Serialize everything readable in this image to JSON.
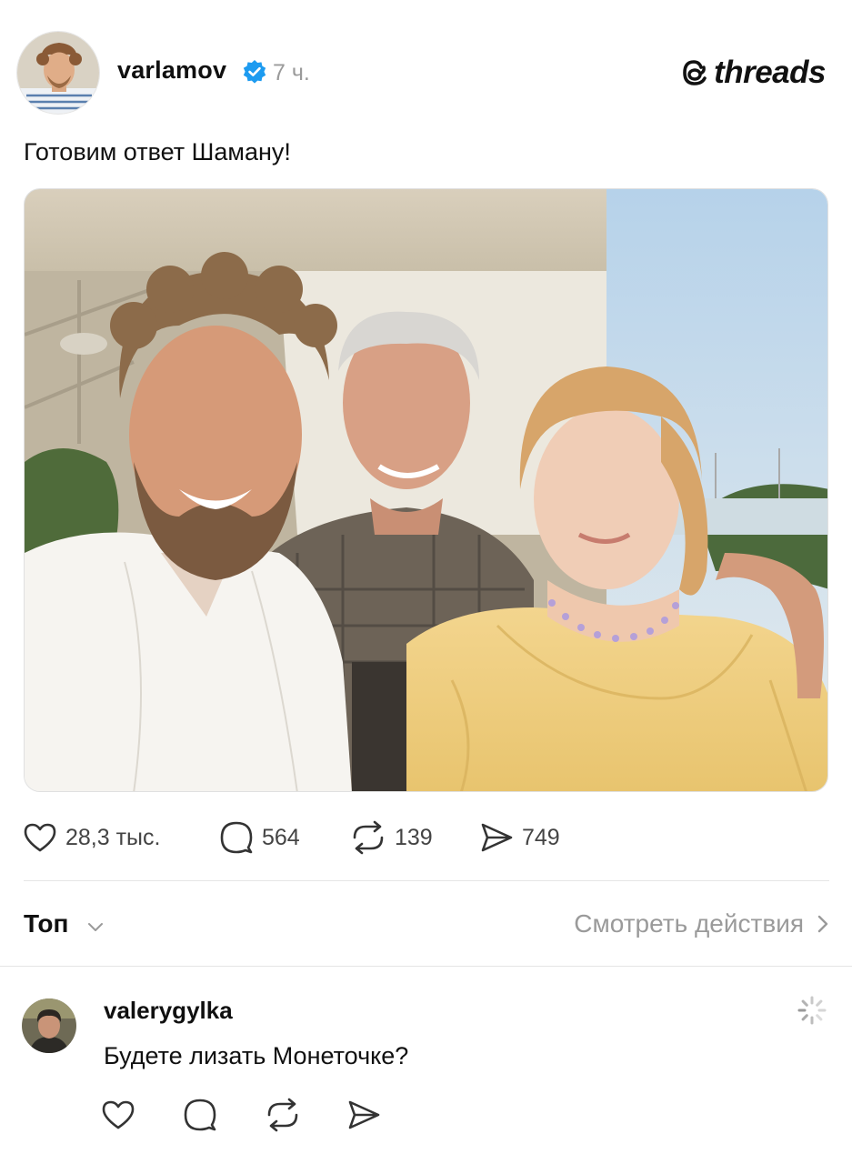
{
  "post": {
    "username": "varlamov",
    "time": "7 ч.",
    "brand": "threads",
    "text": "Готовим ответ Шаману!",
    "likes": "28,3 тыс.",
    "replies": "564",
    "reposts": "139",
    "shares": "749"
  },
  "replies_section": {
    "sort_label": "Топ",
    "view_activity": "Смотреть действия"
  },
  "comment": {
    "username": "valerygylka",
    "text": "Будете лизать Монеточке?"
  },
  "colors": {
    "verified": "#1d9bf0",
    "muted_text": "#9a9a9a"
  }
}
